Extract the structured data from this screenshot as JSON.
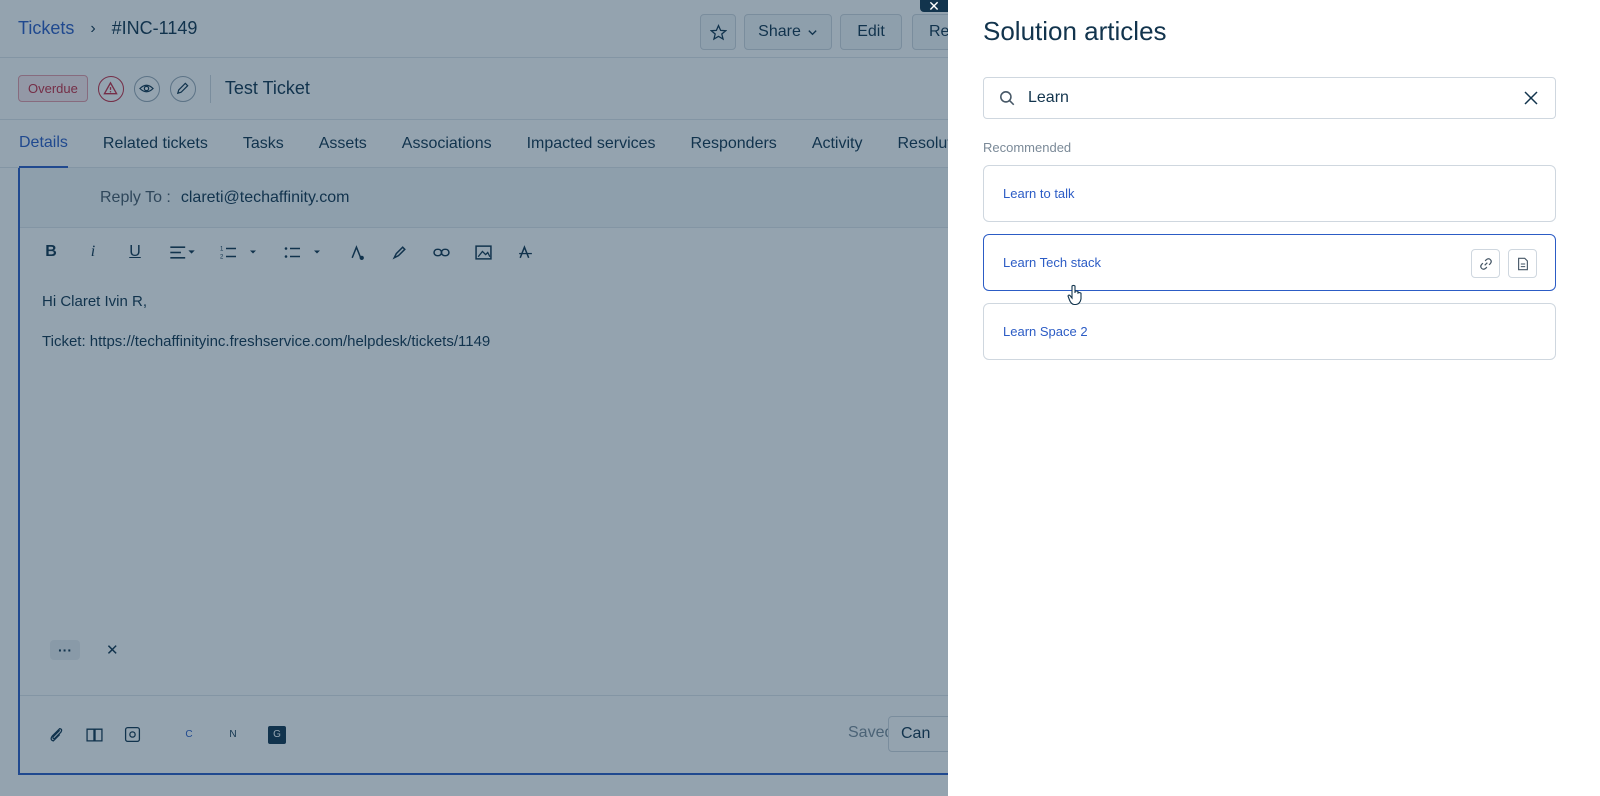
{
  "breadcrumb": {
    "root": "Tickets",
    "current": "#INC-1149"
  },
  "ticket": {
    "status_badge": "Overdue",
    "title": "Test Ticket",
    "buttons": {
      "share": "Share",
      "edit": "Edit",
      "truncated": "Re"
    }
  },
  "tabs": [
    "Details",
    "Related tickets",
    "Tasks",
    "Assets",
    "Associations",
    "Impacted services",
    "Responders",
    "Activity",
    "Resoluti"
  ],
  "editor": {
    "reply_to_label": "Reply To :",
    "reply_to_value": "clareti@techaffinity.com",
    "greeting": "Hi Claret Ivin R,",
    "ticket_line": "Ticket: https://techaffinityinc.freshservice.com/helpdesk/tickets/1149",
    "more": "···",
    "saved": "Saved",
    "cancel": "Can",
    "ext_c": "C",
    "ext_n": "N",
    "ext_g": "G"
  },
  "drawer": {
    "title": "Solution articles",
    "search_value": "Learn",
    "section_label": "Recommended",
    "articles": [
      {
        "title": "Learn to talk"
      },
      {
        "title": "Learn Tech stack"
      },
      {
        "title": "Learn Space 2"
      }
    ]
  },
  "colors": {
    "accent": "#2c5cc5",
    "text": "#12344d",
    "overdue": "#c62a42"
  },
  "icons": [
    "chevron-right-icon",
    "alert-icon",
    "eye-icon",
    "pencil-icon",
    "star-icon",
    "chevron-down-icon",
    "search-icon",
    "close-icon",
    "link-icon",
    "document-icon",
    "attach-icon",
    "book-icon",
    "ai-icon"
  ]
}
